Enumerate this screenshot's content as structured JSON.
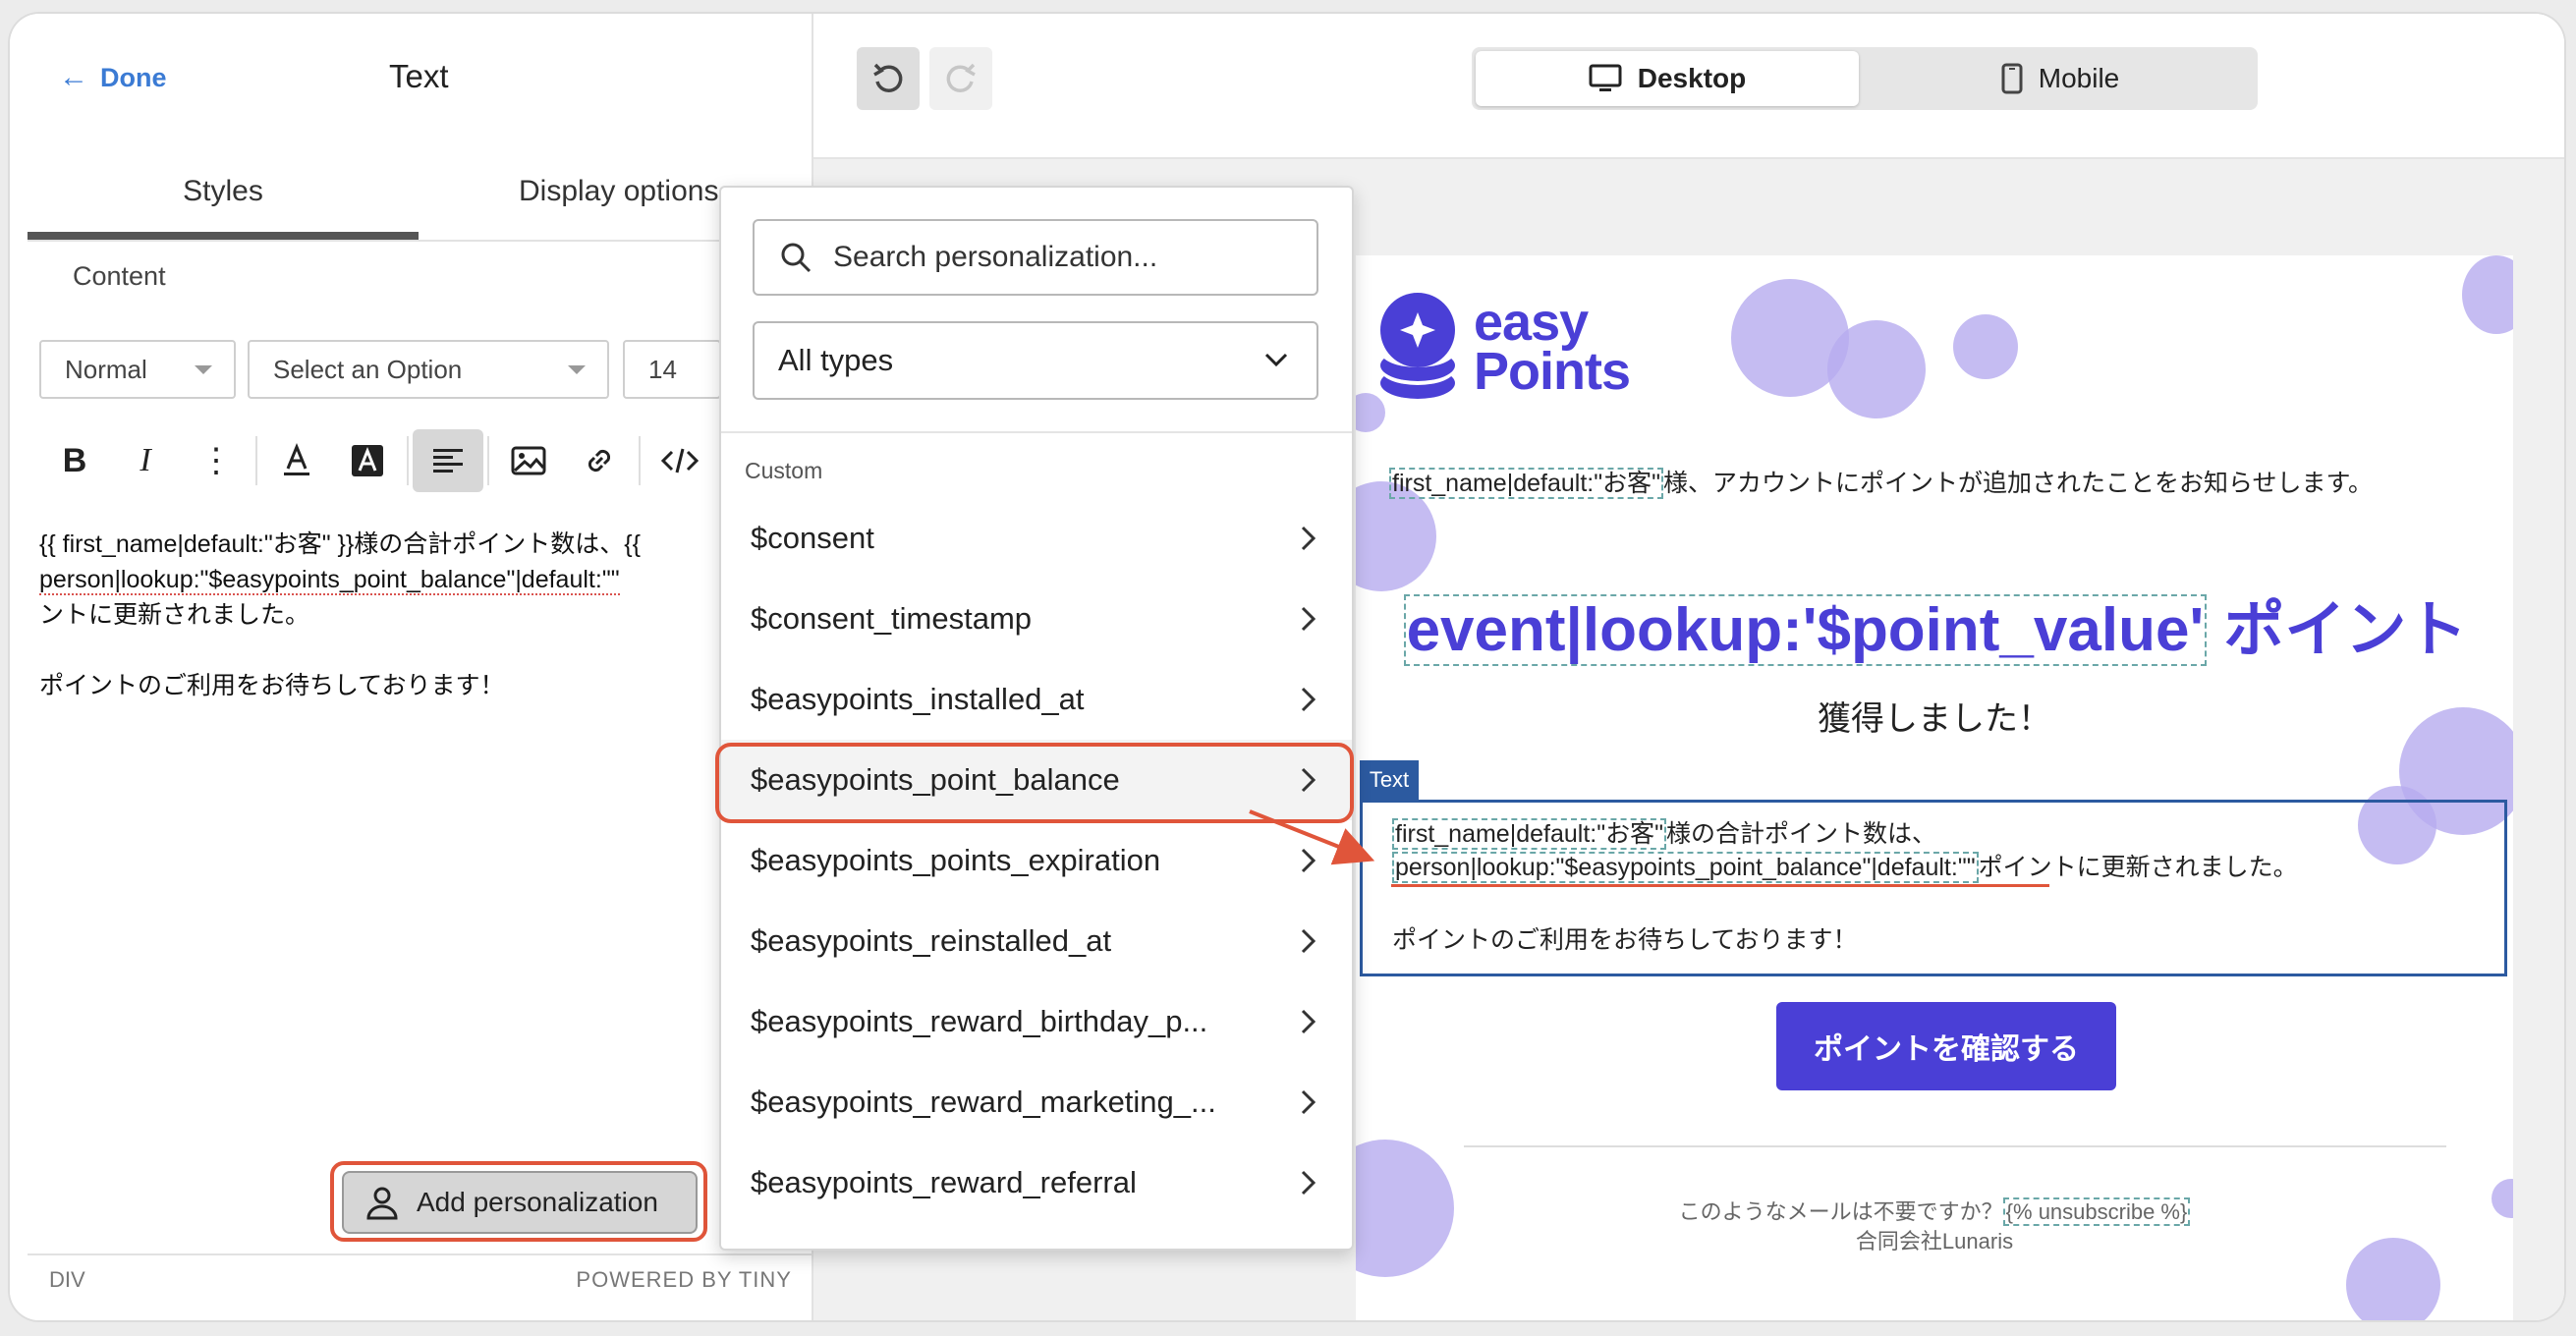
{
  "left_panel": {
    "done_label": "Done",
    "title": "Text",
    "tabs": [
      {
        "label": "Styles"
      },
      {
        "label": "Display options"
      }
    ],
    "content_label": "Content",
    "format_select": "Normal",
    "option_select_placeholder": "Select an Option",
    "font_size": "14",
    "editor_lines": [
      "{{ first_name|default:\"お客\" }}様の合計ポイント数は、{{",
      "person|lookup:\"$easypoints_point_balance\"|default:\"\"",
      "ントに更新されました。",
      "",
      "ポイントのご利用をお待ちしております！"
    ],
    "add_personalization_label": "Add personalization",
    "status_left": "DIV",
    "status_right": "POWERED BY TINY"
  },
  "toolbar_icons": [
    "bold-icon",
    "italic-icon",
    "more-icon",
    "text-color-icon",
    "background-color-icon",
    "align-left-icon",
    "image-icon",
    "link-icon",
    "code-icon"
  ],
  "preview_header": {
    "desktop_label": "Desktop",
    "mobile_label": "Mobile"
  },
  "personalization_popover": {
    "search_placeholder": "Search personalization...",
    "type_filter": "All types",
    "section_label": "Custom",
    "items": [
      "$consent",
      "$consent_timestamp",
      "$easypoints_installed_at",
      "$easypoints_point_balance",
      "$easypoints_points_expiration",
      "$easypoints_reinstalled_at",
      "$easypoints_reward_birthday_p...",
      "$easypoints_reward_marketing_...",
      "$easypoints_reward_referral"
    ],
    "highlighted_index": 3
  },
  "email": {
    "logo_line1": "easy",
    "logo_line2": "Points",
    "line1_token": "first_name|default:\"お客\"",
    "line1_rest": "様、アカウントにポイントが追加されたことをお知らせします。",
    "heading_token": "event|lookup:'$point_value'",
    "heading_rest": " ポイント",
    "subheading": "獲得しました！",
    "text_badge": "Text",
    "block_line1_token": "first_name|default:\"お客\"",
    "block_line1_rest": "様の合計ポイント数は、",
    "block_line2_token": "person|lookup:\"$easypoints_point_balance\"|default:\"\"",
    "block_line2_rest": "ポイントに更新されました。",
    "block_line3": "ポイントのご利用をお待ちしております！",
    "cta_label": "ポイントを確認する",
    "footer_text": "このようなメールは不要ですか？",
    "footer_token": "{% unsubscribe %}",
    "footer_company": "合同会社Lunaris"
  },
  "colors": {
    "brand": "#4a3fd6",
    "annotation": "#e0553a",
    "selection": "#2c5aa0",
    "bubble": "#b7abef"
  }
}
